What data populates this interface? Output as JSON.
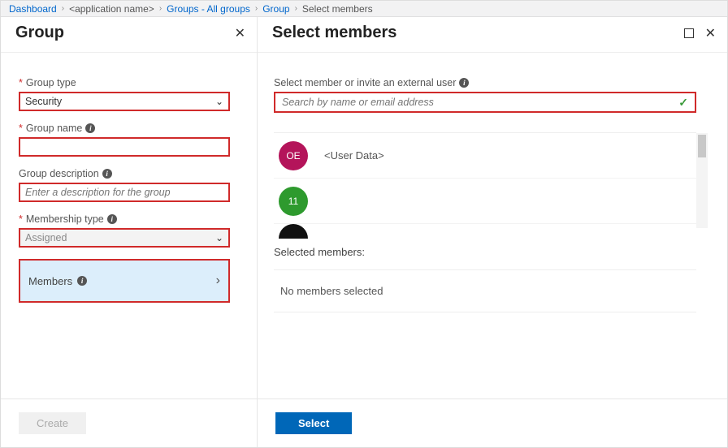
{
  "breadcrumb": {
    "dashboard": "Dashboard",
    "app": "<application name>",
    "groups": "Groups - All groups",
    "group": "Group",
    "current": "Select members"
  },
  "left": {
    "title": "Group",
    "group_type_label": "Group type",
    "group_type_value": "Security",
    "group_name_label": "Group name",
    "group_name_value": "",
    "group_desc_label": "Group description",
    "group_desc_placeholder": "Enter a description for the group",
    "membership_type_label": "Membership type",
    "membership_type_value": "Assigned",
    "members_label": "Members",
    "create_btn": "Create"
  },
  "right": {
    "title": "Select members",
    "search_label": "Select member or invite an external user",
    "search_placeholder": "Search by name or email address",
    "rows": [
      {
        "initials": "OE",
        "name": "<User Data>",
        "color": "pink"
      },
      {
        "initials": "11",
        "name": "",
        "color": "green"
      }
    ],
    "selected_label": "Selected members:",
    "no_members": "No members selected",
    "select_btn": "Select"
  }
}
